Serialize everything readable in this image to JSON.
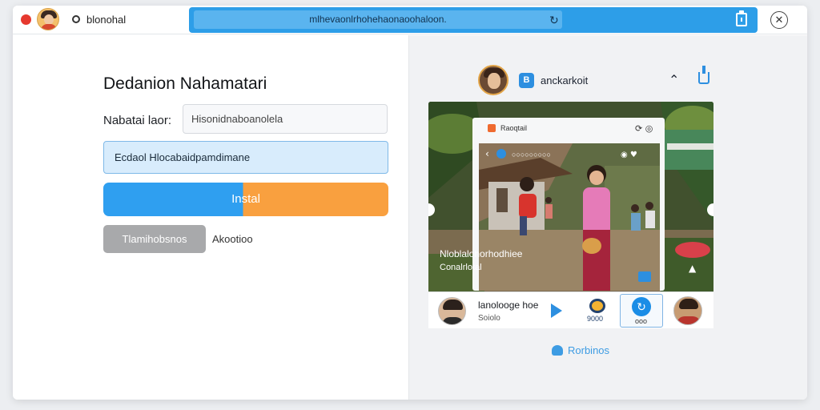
{
  "titlebar": {
    "app_name": "blonohal",
    "url": "mlhevaonlrhohehaonaoohaloon.",
    "icons": [
      "close-dot",
      "avatar",
      "pin-icon",
      "reload-icon",
      "clipboard-icon",
      "close-icon"
    ]
  },
  "form": {
    "heading": "Dedanion Nahamatari",
    "field_label": "Nabatai laor:",
    "field_value": "Hisonidnaboanolela",
    "select_value": "Ecdaol Hlocabaidpamdimane",
    "install_label": "Instal",
    "secondary_label": "Tlamihobsnos",
    "link_label": "Akootioo"
  },
  "preview": {
    "brand_icon": "B",
    "brand_name": "anckarkoit",
    "inner_card": {
      "title": "Raoqtail",
      "caption_1": "Nloblalohorhodhiee",
      "caption_2": "Conalrlotal"
    },
    "bottom_bar": {
      "title": "lanolooge hoe",
      "subtitle": "Soiolo",
      "item_mid": "9000",
      "item_selected": "ooo"
    },
    "footer_link": "Rorbinos"
  },
  "colors": {
    "accent_blue": "#2f9ff0",
    "accent_orange": "#f9a03f",
    "urlbar": "#2d9ee8"
  }
}
